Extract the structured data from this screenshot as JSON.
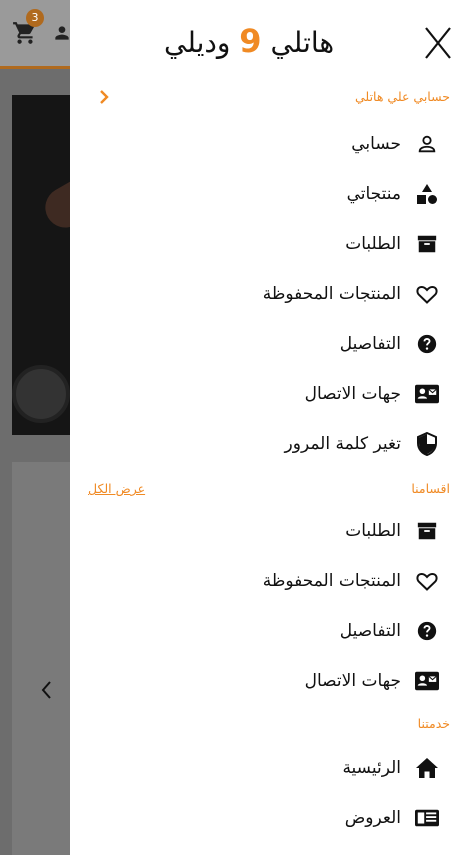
{
  "background": {
    "cart_count": "3"
  },
  "drawer": {
    "close_label": "X",
    "brand_part1": "هاتلي",
    "brand_number": "9",
    "brand_part2": "وديلي",
    "account_section": {
      "title": "حسابي علي هاتلي",
      "items": [
        {
          "label": "حسابي",
          "icon": "person-icon"
        },
        {
          "label": "منتجاتي",
          "icon": "shapes-icon"
        },
        {
          "label": "الطلبات",
          "icon": "archive-icon"
        },
        {
          "label": "المنتجات المحفوظة",
          "icon": "heart-icon"
        },
        {
          "label": "التفاصيل",
          "icon": "help-circle-icon"
        },
        {
          "label": "جهات الاتصال",
          "icon": "contact-card-icon"
        },
        {
          "label": "تغير كلمة المرور",
          "icon": "shield-icon"
        }
      ]
    },
    "categories_section": {
      "title": "اقسامنا",
      "view_all": "عرض الكل",
      "items": [
        {
          "label": "الطلبات",
          "icon": "archive-icon"
        },
        {
          "label": "المنتجات المحفوظة",
          "icon": "heart-icon"
        },
        {
          "label": "التفاصيل",
          "icon": "help-circle-icon"
        },
        {
          "label": "جهات الاتصال",
          "icon": "contact-card-icon"
        }
      ]
    },
    "services_section": {
      "title": "خدمتنا",
      "items": [
        {
          "label": "الرئيسية",
          "icon": "home-icon"
        },
        {
          "label": "العروض",
          "icon": "newspaper-icon"
        }
      ]
    },
    "accent_color": "#f08a24"
  }
}
